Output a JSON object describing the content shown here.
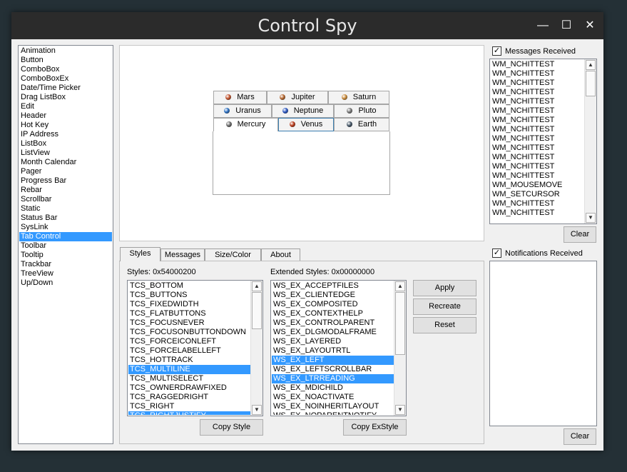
{
  "window": {
    "title": "Control Spy",
    "minimize": "—",
    "maximize": "☐",
    "close": "✕"
  },
  "controls": {
    "items": [
      "Animation",
      "Button",
      "ComboBox",
      "ComboBoxEx",
      "Date/Time Picker",
      "Drag ListBox",
      "Edit",
      "Header",
      "Hot Key",
      "IP Address",
      "ListBox",
      "ListView",
      "Month Calendar",
      "Pager",
      "Progress Bar",
      "Rebar",
      "Scrollbar",
      "Static",
      "Status Bar",
      "SysLink",
      "Tab Control",
      "Toolbar",
      "Tooltip",
      "Trackbar",
      "TreeView",
      "Up/Down"
    ],
    "selected": "Tab Control"
  },
  "demo_tabs": {
    "row1": [
      {
        "label": "Mars",
        "icon": "mars-icon",
        "color": "#c0502a"
      },
      {
        "label": "Jupiter",
        "icon": "jupiter-icon",
        "color": "#b5662e"
      },
      {
        "label": "Saturn",
        "icon": "saturn-icon",
        "color": "#c98a3a"
      }
    ],
    "row2": [
      {
        "label": "Uranus",
        "icon": "uranus-icon",
        "color": "#2a6ec0"
      },
      {
        "label": "Neptune",
        "icon": "neptune-icon",
        "color": "#2a56c0"
      },
      {
        "label": "Pluto",
        "icon": "pluto-icon",
        "color": "#777777"
      }
    ],
    "row3": [
      {
        "label": "Mercury",
        "icon": "mercury-icon",
        "color": "#6a6a6a"
      },
      {
        "label": "Venus",
        "icon": "venus-icon",
        "color": "#b83a1a"
      },
      {
        "label": "Earth",
        "icon": "earth-icon",
        "color": "#445566"
      }
    ]
  },
  "bottom_tabs": [
    "Styles",
    "Messages",
    "Size/Color",
    "About"
  ],
  "styles": {
    "label": "Styles: 0x54000200",
    "items": [
      "TCS_BOTTOM",
      "TCS_BUTTONS",
      "TCS_FIXEDWIDTH",
      "TCS_FLATBUTTONS",
      "TCS_FOCUSNEVER",
      "TCS_FOCUSONBUTTONDOWN",
      "TCS_FORCEICONLEFT",
      "TCS_FORCELABELLEFT",
      "TCS_HOTTRACK",
      "TCS_MULTILINE",
      "TCS_MULTISELECT",
      "TCS_OWNERDRAWFIXED",
      "TCS_RAGGEDRIGHT",
      "TCS_RIGHT",
      "TCS_RIGHTJUSTIFY"
    ],
    "selected": [
      "TCS_MULTILINE",
      "TCS_RIGHTJUSTIFY"
    ],
    "copy_button": "Copy Style"
  },
  "ex_styles": {
    "label": "Extended Styles: 0x00000000",
    "items": [
      "WS_EX_ACCEPTFILES",
      "WS_EX_CLIENTEDGE",
      "WS_EX_COMPOSITED",
      "WS_EX_CONTEXTHELP",
      "WS_EX_CONTROLPARENT",
      "WS_EX_DLGMODALFRAME",
      "WS_EX_LAYERED",
      "WS_EX_LAYOUTRTL",
      "WS_EX_LEFT",
      "WS_EX_LEFTSCROLLBAR",
      "WS_EX_LTRREADING",
      "WS_EX_MDICHILD",
      "WS_EX_NOACTIVATE",
      "WS_EX_NOINHERITLAYOUT",
      "WS_EX_NOPARENTNOTIFY"
    ],
    "selected": [
      "WS_EX_LEFT",
      "WS_EX_LTRREADING"
    ],
    "copy_button": "Copy ExStyle"
  },
  "actions": {
    "apply": "Apply",
    "recreate": "Recreate",
    "reset": "Reset"
  },
  "messages": {
    "label": "Messages Received",
    "checked": true,
    "items": [
      "WM_NCHITTEST",
      "WM_NCHITTEST",
      "WM_NCHITTEST",
      "WM_NCHITTEST",
      "WM_NCHITTEST",
      "WM_NCHITTEST",
      "WM_NCHITTEST",
      "WM_NCHITTEST",
      "WM_NCHITTEST",
      "WM_NCHITTEST",
      "WM_NCHITTEST",
      "WM_NCHITTEST",
      "WM_NCHITTEST",
      "WM_MOUSEMOVE",
      "WM_SETCURSOR",
      "WM_NCHITTEST",
      "WM_NCHITTEST"
    ],
    "clear": "Clear"
  },
  "notifications": {
    "label": "Notifications Received",
    "checked": true,
    "clear": "Clear"
  }
}
